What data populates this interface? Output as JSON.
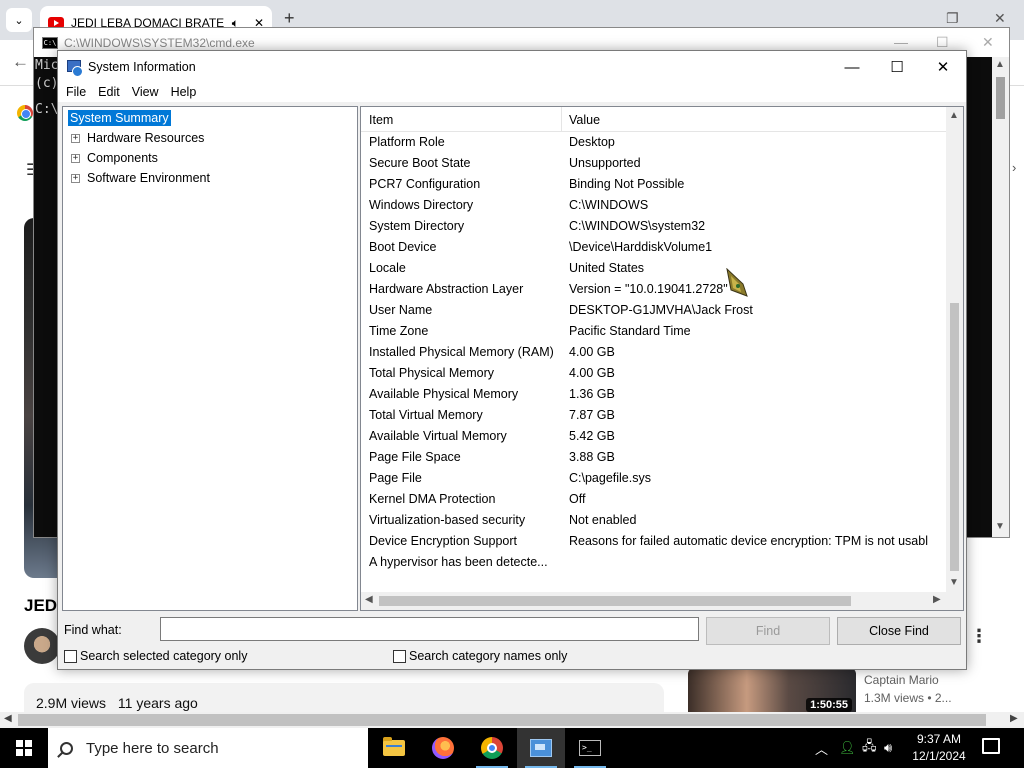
{
  "browser": {
    "tab_title": "JEDI LEBA DOMACI BRATE",
    "video_title_fragment": "JED",
    "views": "2.9M views",
    "age": "11 years ago",
    "recommended": {
      "duration": "1:50:55",
      "channel": "Captain Mario",
      "meta": "1.3M views  •  2..."
    }
  },
  "cmd": {
    "title": "C:\\WINDOWS\\SYSTEM32\\cmd.exe",
    "line1": "Mic",
    "line2": "(c)",
    "line3": "C:\\"
  },
  "msinfo": {
    "title": "System Information",
    "menu": [
      "File",
      "Edit",
      "View",
      "Help"
    ],
    "tree": {
      "root": "System Summary",
      "children": [
        "Hardware Resources",
        "Components",
        "Software Environment"
      ]
    },
    "columns": {
      "item": "Item",
      "value": "Value"
    },
    "rows": [
      {
        "item": "Platform Role",
        "value": "Desktop"
      },
      {
        "item": "Secure Boot State",
        "value": "Unsupported"
      },
      {
        "item": "PCR7 Configuration",
        "value": "Binding Not Possible"
      },
      {
        "item": "Windows Directory",
        "value": "C:\\WINDOWS"
      },
      {
        "item": "System Directory",
        "value": "C:\\WINDOWS\\system32"
      },
      {
        "item": "Boot Device",
        "value": "\\Device\\HarddiskVolume1"
      },
      {
        "item": "Locale",
        "value": "United States"
      },
      {
        "item": "Hardware Abstraction Layer",
        "value": "Version = \"10.0.19041.2728\""
      },
      {
        "item": "User Name",
        "value": "DESKTOP-G1JMVHA\\Jack Frost"
      },
      {
        "item": "Time Zone",
        "value": "Pacific Standard Time"
      },
      {
        "item": "Installed Physical Memory (RAM)",
        "value": "4.00 GB"
      },
      {
        "item": "Total Physical Memory",
        "value": "4.00 GB"
      },
      {
        "item": "Available Physical Memory",
        "value": "1.36 GB"
      },
      {
        "item": "Total Virtual Memory",
        "value": "7.87 GB"
      },
      {
        "item": "Available Virtual Memory",
        "value": "5.42 GB"
      },
      {
        "item": "Page File Space",
        "value": "3.88 GB"
      },
      {
        "item": "Page File",
        "value": "C:\\pagefile.sys"
      },
      {
        "item": "Kernel DMA Protection",
        "value": "Off"
      },
      {
        "item": "Virtualization-based security",
        "value": "Not enabled"
      },
      {
        "item": "Device Encryption Support",
        "value": "Reasons for failed automatic device encryption: TPM is not usabl"
      },
      {
        "item": "A hypervisor has been detecte...",
        "value": ""
      }
    ],
    "find": {
      "label": "Find what:",
      "value": "",
      "find_button": "Find",
      "close_find_button": "Close Find",
      "search_selected_label": "Search selected category only",
      "search_names_label": "Search category names only"
    }
  },
  "taskbar": {
    "search_placeholder": "Type here to search",
    "time": "9:37 AM",
    "date": "12/1/2024",
    "apps": [
      "file-explorer",
      "firefox",
      "chrome",
      "system-information",
      "command-prompt"
    ]
  },
  "colors": {
    "selection": "#0078d7",
    "taskbar": "#000000",
    "youtube_red": "#e60000"
  }
}
